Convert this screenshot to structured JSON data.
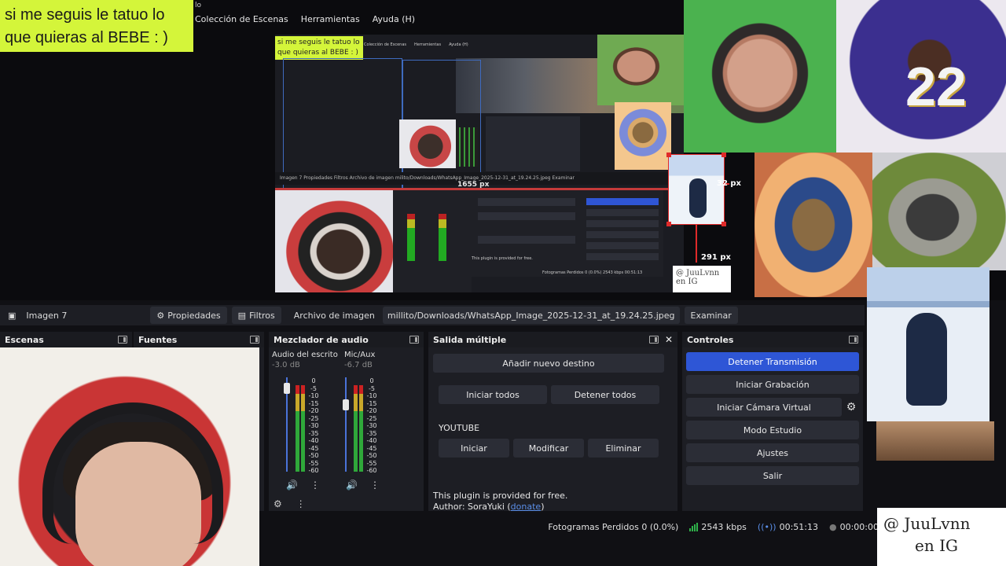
{
  "overlay": {
    "line1": "si me seguis le tatuo lo",
    "line2": "que quieras al BEBE : )"
  },
  "menubar": {
    "items": [
      "Colección de Escenas",
      "Herramientas",
      "Ayuda (H)"
    ],
    "clip": "lo"
  },
  "nested_preview": {
    "overlay_line1": "si me seguis le tatuo lo",
    "overlay_line2": "que quieras al BEBE : )",
    "menu": [
      "Colección de Escenas",
      "Herramientas",
      "Ayuda (H)"
    ],
    "bar_text": "Imagen 7     Propiedades     Filtros     Archivo de imagen     milito/Downloads/WhatsApp_Image_2025-12-31_at_19.24.25.jpeg     Examinar",
    "px_label": "1655 px",
    "free_text": "This plugin is provided for free.",
    "status_text": "Fotogramas Perdidos 0 (0.0%)   2543 kbps   00:51:13"
  },
  "selection": {
    "right_px": "32 px",
    "bottom_px": "291 px"
  },
  "preview_images": {
    "jersey_number": "22",
    "watermark_small_line1": "@ JuuLvnn",
    "watermark_small_line2": "en IG"
  },
  "source_toolbar": {
    "source_name": "Imagen 7",
    "properties_label": "Propiedades",
    "filters_label": "Filtros",
    "file_label": "Archivo de imagen",
    "file_path": "millito/Downloads/WhatsApp_Image_2025-12-31_at_19.24.25.jpeg",
    "browse_label": "Examinar"
  },
  "docks": {
    "scenes": "Escenas",
    "sources": "Fuentes",
    "mixer": "Mezclador de audio",
    "multi_output": "Salida múltiple",
    "controls": "Controles"
  },
  "mixer": {
    "channels": [
      {
        "name": "Audio del escrito",
        "db": "-3.0 dB",
        "level": 0.88
      },
      {
        "name": "Mic/Aux",
        "db": "-6.7 dB",
        "level": 0.71
      }
    ],
    "scale": [
      "0",
      "-5",
      "-10",
      "-15",
      "-20",
      "-25",
      "-30",
      "-35",
      "-40",
      "-45",
      "-50",
      "-55",
      "-60"
    ]
  },
  "multi_output": {
    "add_destination": "Añadir nuevo destino",
    "start_all": "Iniciar todos",
    "stop_all": "Detener todos",
    "service": "YOUTUBE",
    "start": "Iniciar",
    "modify": "Modificar",
    "delete": "Eliminar",
    "free_text": "This plugin is provided for free.",
    "author_prefix": "Author: SoraYuki (",
    "donate": "donate",
    "author_suffix": ")"
  },
  "controls": {
    "stop_stream": "Detener Transmisión",
    "start_recording": "Iniciar Grabación",
    "start_virtual_cam": "Iniciar Cámara Virtual",
    "studio_mode": "Modo Estudio",
    "settings": "Ajustes",
    "exit": "Salir"
  },
  "status": {
    "dropped_frames": "Fotogramas Perdidos 0 (0.0%)",
    "bitrate": "2543 kbps",
    "stream_time": "00:51:13",
    "rec_time": "00:00:00"
  },
  "watermark": {
    "line1": "@ JuuLvnn",
    "line2": "en IG"
  },
  "colors": {
    "accent": "#2e56d6",
    "overlay_bg": "#d4f53a",
    "selection": "#e02a2a"
  }
}
